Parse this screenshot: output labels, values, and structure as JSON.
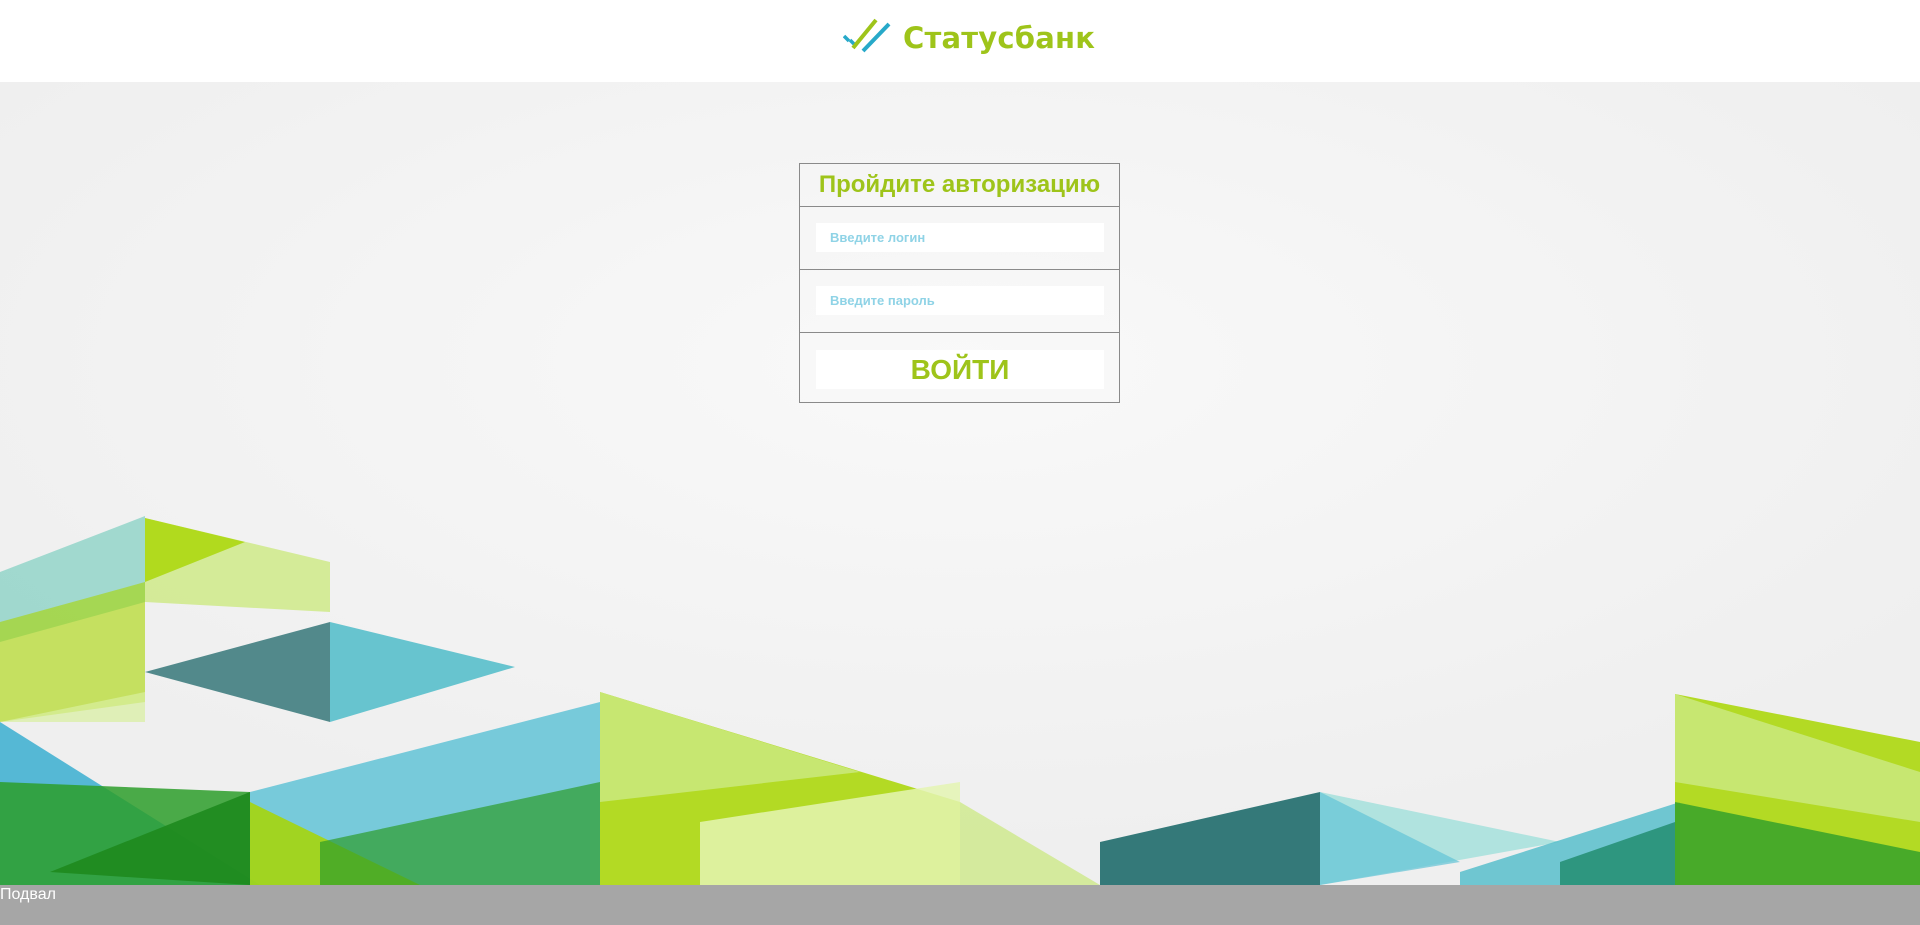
{
  "header": {
    "logo_text": "Статусбанк"
  },
  "colors": {
    "brand_green": "#9ec41a",
    "brand_teal": "#27a9c9",
    "placeholder": "#8fd3e6",
    "footer_bg": "#a6a6a6"
  },
  "login_form": {
    "title": "Пройдите авторизацию",
    "login_placeholder": "Введите логин",
    "password_placeholder": "Введите пароль",
    "submit_label": "ВОЙТИ"
  },
  "footer": {
    "text": "Подвал"
  },
  "icons": [
    "statusbank-logo-icon"
  ]
}
